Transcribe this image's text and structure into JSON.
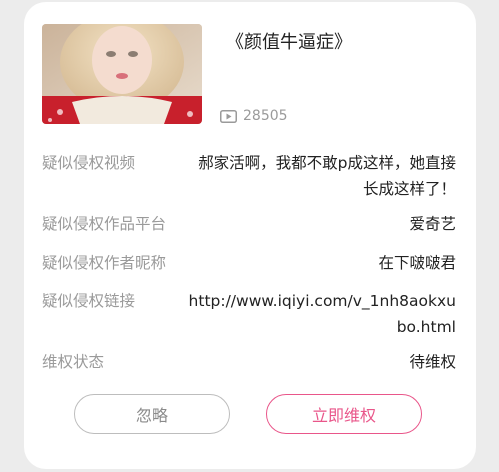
{
  "video": {
    "title": "《颜值牛逼症》",
    "play_count": "28505"
  },
  "details": [
    {
      "label": "疑似侵权视频",
      "value": "郝家活啊，我都不敢p成这样，她直接长成这样了！"
    },
    {
      "label": "疑似侵权作品平台",
      "value": "爱奇艺"
    },
    {
      "label": "疑似侵权作者昵称",
      "value": "在下啵啵君"
    },
    {
      "label": "疑似侵权链接",
      "value": "http://www.iqiyi.com/v_1nh8aokxubo.html"
    },
    {
      "label": "维权状态",
      "value": "待维权"
    }
  ],
  "actions": {
    "ignore_label": "忽略",
    "defend_label": "立即维权"
  },
  "colors": {
    "accent": "#e9568a",
    "muted_text": "#9a9a9a",
    "primary_text": "#222222"
  }
}
